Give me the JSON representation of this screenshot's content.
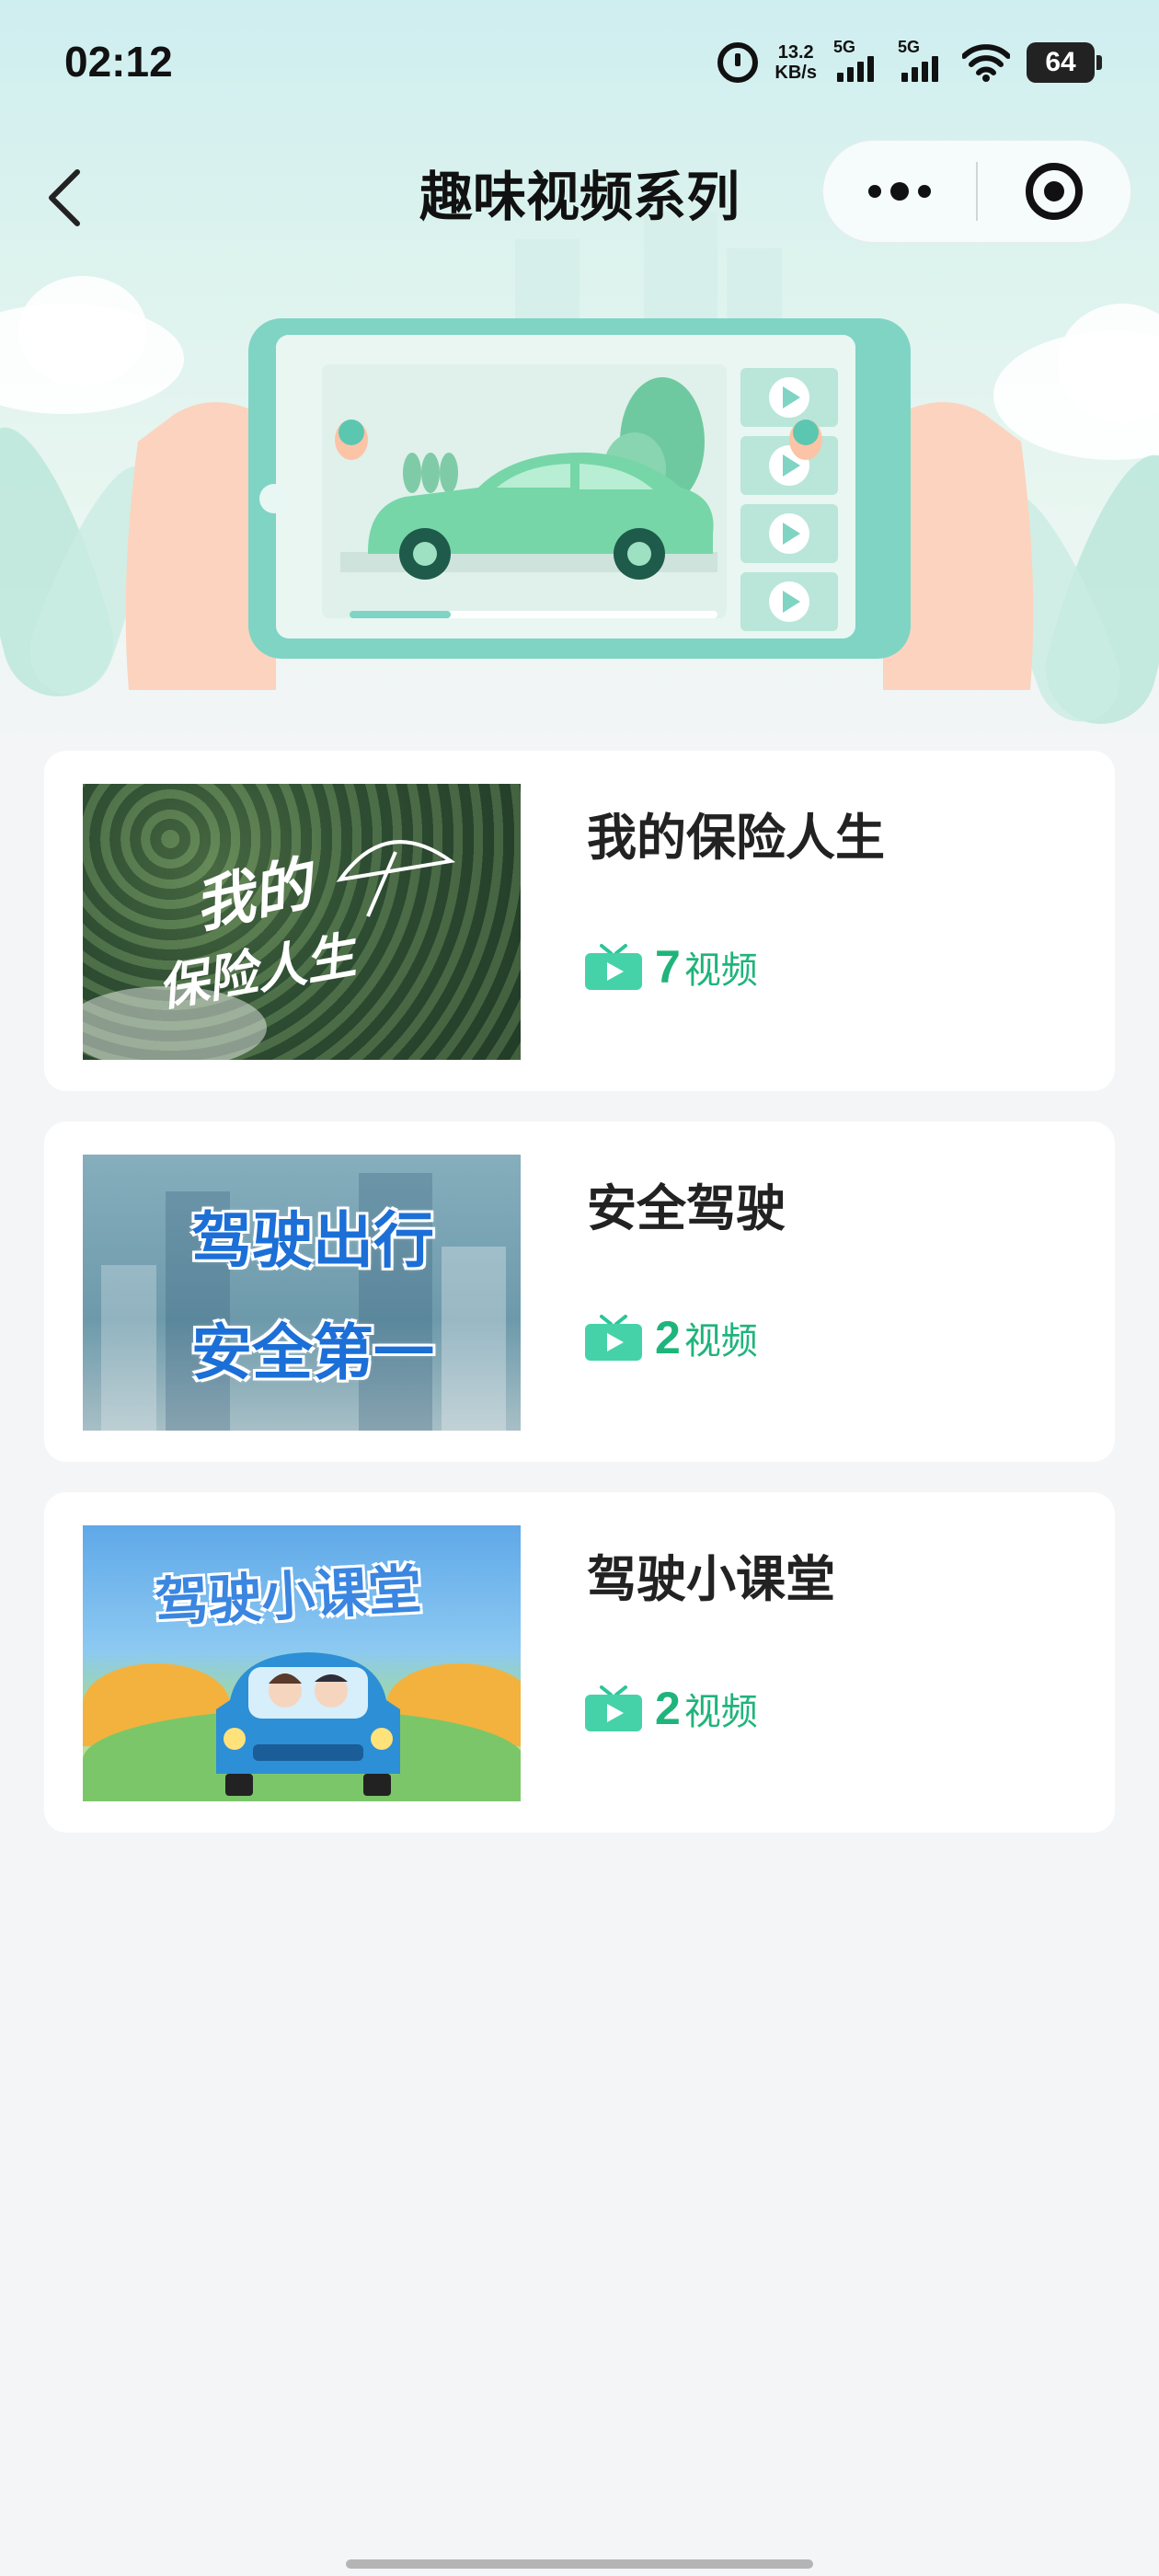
{
  "status_bar": {
    "time": "02:12",
    "net_speed_value": "13.2",
    "net_speed_unit": "KB/s",
    "sim1_label": "5G",
    "sim2_label": "5G",
    "battery": "64"
  },
  "nav": {
    "title": "趣味视频系列"
  },
  "series": [
    {
      "title": "我的保险人生",
      "count": "7",
      "count_label": "视频",
      "thumb_text_line1": "我的",
      "thumb_text_line2": "保险人生"
    },
    {
      "title": "安全驾驶",
      "count": "2",
      "count_label": "视频",
      "thumb_text_line1": "驾驶出行",
      "thumb_text_line2": "安全第一"
    },
    {
      "title": "驾驶小课堂",
      "count": "2",
      "count_label": "视频",
      "thumb_text_line1": "驾驶小课堂"
    }
  ],
  "colors": {
    "accent_green": "#1fb47b",
    "hero_teal": "#7fd4c4",
    "background": "#f4f5f7"
  }
}
